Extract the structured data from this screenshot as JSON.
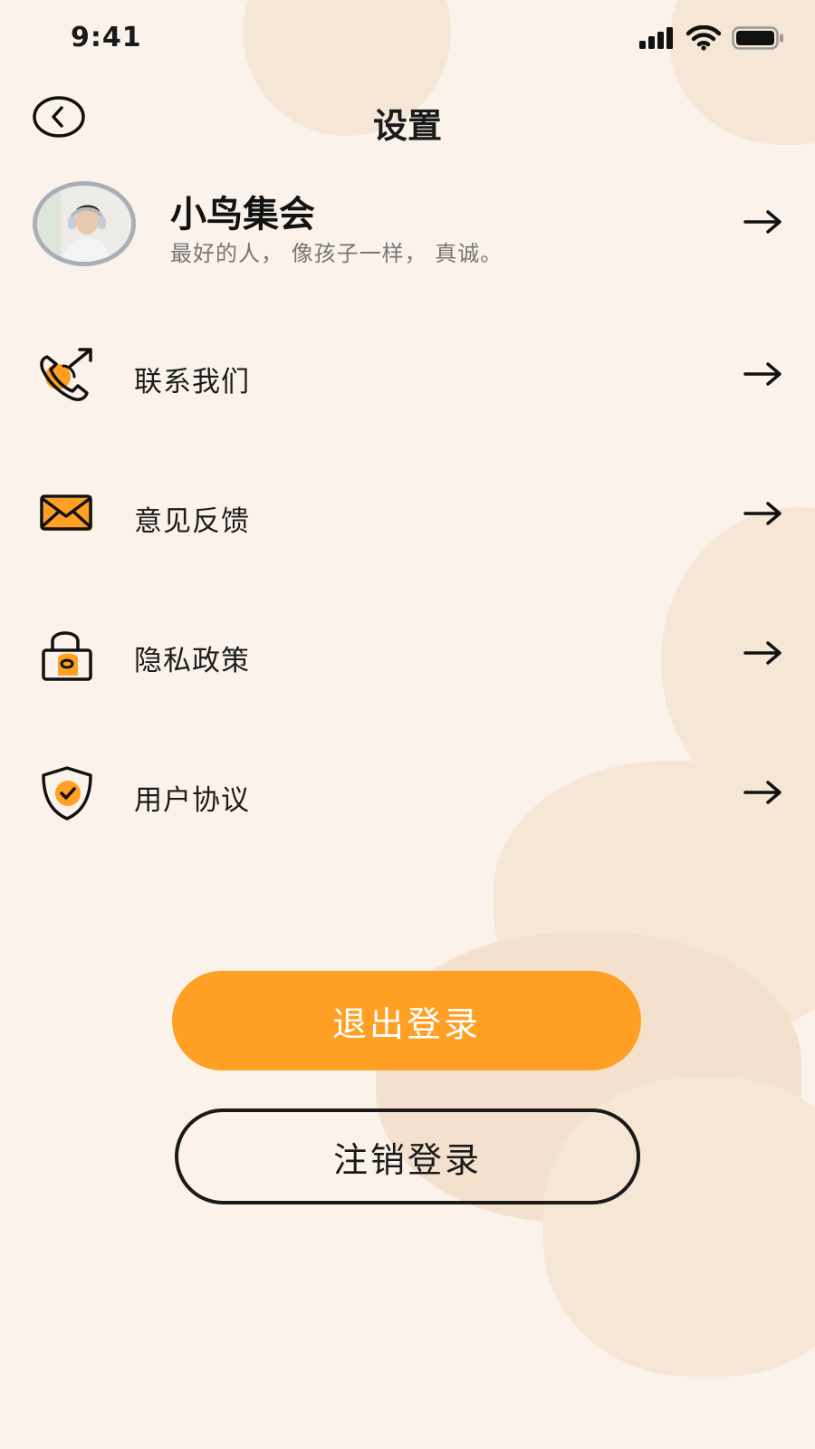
{
  "status_bar": {
    "time": "9:41"
  },
  "header": {
    "title": "设置"
  },
  "profile": {
    "name": "小鸟集会",
    "motto": "最好的人， 像孩子一样， 真诚。"
  },
  "menu": [
    {
      "label": "联系我们",
      "icon": "phone-call-icon"
    },
    {
      "label": "意见反馈",
      "icon": "envelope-icon"
    },
    {
      "label": "隐私政策",
      "icon": "lock-icon"
    },
    {
      "label": "用户协议",
      "icon": "shield-check-icon"
    }
  ],
  "buttons": {
    "logout_label": "退出登录",
    "deregister_label": "注销登录"
  },
  "colors": {
    "background": "#FBF3EB",
    "accent": "#FF9F23",
    "blob": "#F5E6D6",
    "text": "#1a1a1a"
  }
}
